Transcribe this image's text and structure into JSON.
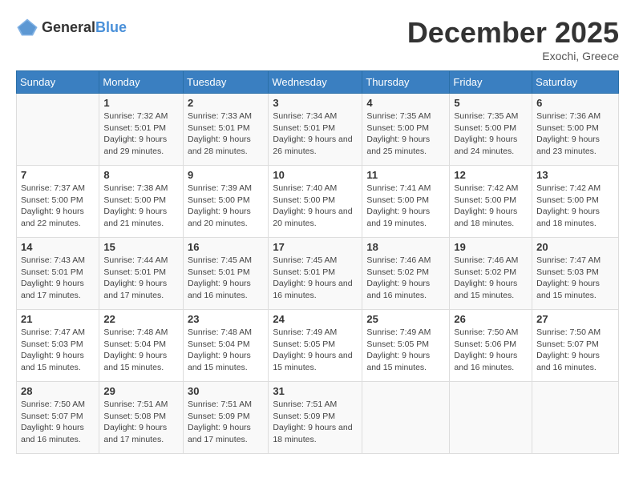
{
  "header": {
    "logo_general": "General",
    "logo_blue": "Blue",
    "title": "December 2025",
    "location": "Exochi, Greece"
  },
  "weekdays": [
    "Sunday",
    "Monday",
    "Tuesday",
    "Wednesday",
    "Thursday",
    "Friday",
    "Saturday"
  ],
  "weeks": [
    [
      {
        "day": "",
        "sunrise": "",
        "sunset": "",
        "daylight": ""
      },
      {
        "day": "1",
        "sunrise": "Sunrise: 7:32 AM",
        "sunset": "Sunset: 5:01 PM",
        "daylight": "Daylight: 9 hours and 29 minutes."
      },
      {
        "day": "2",
        "sunrise": "Sunrise: 7:33 AM",
        "sunset": "Sunset: 5:01 PM",
        "daylight": "Daylight: 9 hours and 28 minutes."
      },
      {
        "day": "3",
        "sunrise": "Sunrise: 7:34 AM",
        "sunset": "Sunset: 5:01 PM",
        "daylight": "Daylight: 9 hours and 26 minutes."
      },
      {
        "day": "4",
        "sunrise": "Sunrise: 7:35 AM",
        "sunset": "Sunset: 5:00 PM",
        "daylight": "Daylight: 9 hours and 25 minutes."
      },
      {
        "day": "5",
        "sunrise": "Sunrise: 7:35 AM",
        "sunset": "Sunset: 5:00 PM",
        "daylight": "Daylight: 9 hours and 24 minutes."
      },
      {
        "day": "6",
        "sunrise": "Sunrise: 7:36 AM",
        "sunset": "Sunset: 5:00 PM",
        "daylight": "Daylight: 9 hours and 23 minutes."
      }
    ],
    [
      {
        "day": "7",
        "sunrise": "Sunrise: 7:37 AM",
        "sunset": "Sunset: 5:00 PM",
        "daylight": "Daylight: 9 hours and 22 minutes."
      },
      {
        "day": "8",
        "sunrise": "Sunrise: 7:38 AM",
        "sunset": "Sunset: 5:00 PM",
        "daylight": "Daylight: 9 hours and 21 minutes."
      },
      {
        "day": "9",
        "sunrise": "Sunrise: 7:39 AM",
        "sunset": "Sunset: 5:00 PM",
        "daylight": "Daylight: 9 hours and 20 minutes."
      },
      {
        "day": "10",
        "sunrise": "Sunrise: 7:40 AM",
        "sunset": "Sunset: 5:00 PM",
        "daylight": "Daylight: 9 hours and 20 minutes."
      },
      {
        "day": "11",
        "sunrise": "Sunrise: 7:41 AM",
        "sunset": "Sunset: 5:00 PM",
        "daylight": "Daylight: 9 hours and 19 minutes."
      },
      {
        "day": "12",
        "sunrise": "Sunrise: 7:42 AM",
        "sunset": "Sunset: 5:00 PM",
        "daylight": "Daylight: 9 hours and 18 minutes."
      },
      {
        "day": "13",
        "sunrise": "Sunrise: 7:42 AM",
        "sunset": "Sunset: 5:00 PM",
        "daylight": "Daylight: 9 hours and 18 minutes."
      }
    ],
    [
      {
        "day": "14",
        "sunrise": "Sunrise: 7:43 AM",
        "sunset": "Sunset: 5:01 PM",
        "daylight": "Daylight: 9 hours and 17 minutes."
      },
      {
        "day": "15",
        "sunrise": "Sunrise: 7:44 AM",
        "sunset": "Sunset: 5:01 PM",
        "daylight": "Daylight: 9 hours and 17 minutes."
      },
      {
        "day": "16",
        "sunrise": "Sunrise: 7:45 AM",
        "sunset": "Sunset: 5:01 PM",
        "daylight": "Daylight: 9 hours and 16 minutes."
      },
      {
        "day": "17",
        "sunrise": "Sunrise: 7:45 AM",
        "sunset": "Sunset: 5:01 PM",
        "daylight": "Daylight: 9 hours and 16 minutes."
      },
      {
        "day": "18",
        "sunrise": "Sunrise: 7:46 AM",
        "sunset": "Sunset: 5:02 PM",
        "daylight": "Daylight: 9 hours and 16 minutes."
      },
      {
        "day": "19",
        "sunrise": "Sunrise: 7:46 AM",
        "sunset": "Sunset: 5:02 PM",
        "daylight": "Daylight: 9 hours and 15 minutes."
      },
      {
        "day": "20",
        "sunrise": "Sunrise: 7:47 AM",
        "sunset": "Sunset: 5:03 PM",
        "daylight": "Daylight: 9 hours and 15 minutes."
      }
    ],
    [
      {
        "day": "21",
        "sunrise": "Sunrise: 7:47 AM",
        "sunset": "Sunset: 5:03 PM",
        "daylight": "Daylight: 9 hours and 15 minutes."
      },
      {
        "day": "22",
        "sunrise": "Sunrise: 7:48 AM",
        "sunset": "Sunset: 5:04 PM",
        "daylight": "Daylight: 9 hours and 15 minutes."
      },
      {
        "day": "23",
        "sunrise": "Sunrise: 7:48 AM",
        "sunset": "Sunset: 5:04 PM",
        "daylight": "Daylight: 9 hours and 15 minutes."
      },
      {
        "day": "24",
        "sunrise": "Sunrise: 7:49 AM",
        "sunset": "Sunset: 5:05 PM",
        "daylight": "Daylight: 9 hours and 15 minutes."
      },
      {
        "day": "25",
        "sunrise": "Sunrise: 7:49 AM",
        "sunset": "Sunset: 5:05 PM",
        "daylight": "Daylight: 9 hours and 15 minutes."
      },
      {
        "day": "26",
        "sunrise": "Sunrise: 7:50 AM",
        "sunset": "Sunset: 5:06 PM",
        "daylight": "Daylight: 9 hours and 16 minutes."
      },
      {
        "day": "27",
        "sunrise": "Sunrise: 7:50 AM",
        "sunset": "Sunset: 5:07 PM",
        "daylight": "Daylight: 9 hours and 16 minutes."
      }
    ],
    [
      {
        "day": "28",
        "sunrise": "Sunrise: 7:50 AM",
        "sunset": "Sunset: 5:07 PM",
        "daylight": "Daylight: 9 hours and 16 minutes."
      },
      {
        "day": "29",
        "sunrise": "Sunrise: 7:51 AM",
        "sunset": "Sunset: 5:08 PM",
        "daylight": "Daylight: 9 hours and 17 minutes."
      },
      {
        "day": "30",
        "sunrise": "Sunrise: 7:51 AM",
        "sunset": "Sunset: 5:09 PM",
        "daylight": "Daylight: 9 hours and 17 minutes."
      },
      {
        "day": "31",
        "sunrise": "Sunrise: 7:51 AM",
        "sunset": "Sunset: 5:09 PM",
        "daylight": "Daylight: 9 hours and 18 minutes."
      },
      {
        "day": "",
        "sunrise": "",
        "sunset": "",
        "daylight": ""
      },
      {
        "day": "",
        "sunrise": "",
        "sunset": "",
        "daylight": ""
      },
      {
        "day": "",
        "sunrise": "",
        "sunset": "",
        "daylight": ""
      }
    ]
  ]
}
